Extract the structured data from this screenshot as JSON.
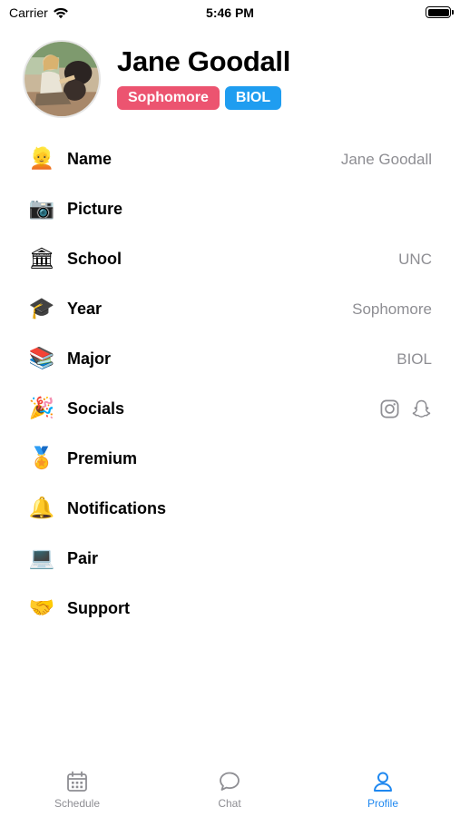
{
  "status_bar": {
    "carrier": "Carrier",
    "time": "5:46 PM"
  },
  "profile": {
    "name": "Jane Goodall",
    "year_badge": "Sophomore",
    "major_badge": "BIOL",
    "colors": {
      "year_badge": "#ec5470",
      "major_badge": "#1f9df0",
      "accent": "#1f88f0"
    }
  },
  "settings": [
    {
      "emoji": "👱",
      "label": "Name",
      "value": "Jane Goodall"
    },
    {
      "emoji": "📷",
      "label": "Picture",
      "value": ""
    },
    {
      "emoji": "🏛",
      "label": "School",
      "value": "UNC"
    },
    {
      "emoji": "🎓",
      "label": "Year",
      "value": "Sophomore"
    },
    {
      "emoji": "📚",
      "label": "Major",
      "value": "BIOL"
    },
    {
      "emoji": "🎉",
      "label": "Socials",
      "value": "",
      "icons": [
        "instagram-icon",
        "snapchat-icon"
      ]
    },
    {
      "emoji": "🏅",
      "label": "Premium",
      "value": ""
    },
    {
      "emoji": "🔔",
      "label": "Notifications",
      "value": ""
    },
    {
      "emoji": "💻",
      "label": "Pair",
      "value": ""
    },
    {
      "emoji": "🤝",
      "label": "Support",
      "value": ""
    }
  ],
  "tab_bar": {
    "tabs": [
      {
        "label": "Schedule",
        "icon": "calendar-icon",
        "active": false
      },
      {
        "label": "Chat",
        "icon": "chat-bubble-icon",
        "active": false
      },
      {
        "label": "Profile",
        "icon": "person-icon",
        "active": true
      }
    ]
  }
}
